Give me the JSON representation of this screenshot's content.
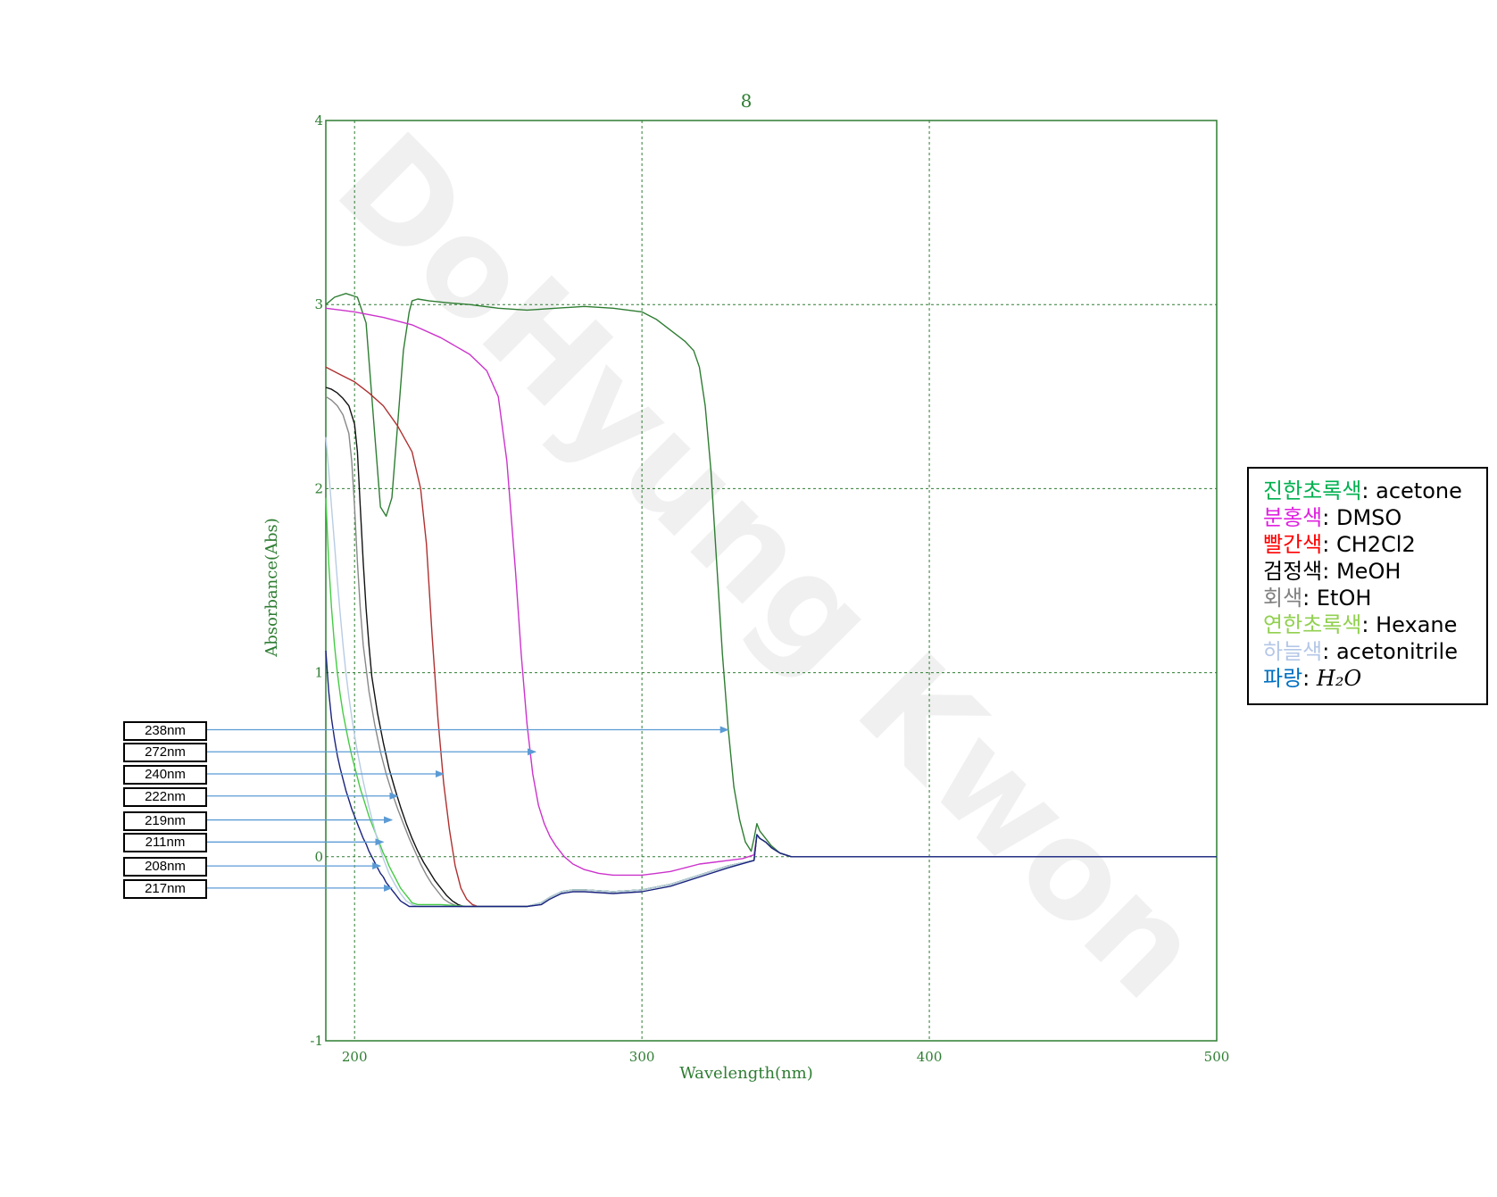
{
  "chart_data": {
    "type": "line",
    "title": "8",
    "xlabel": "Wavelength(nm)",
    "ylabel": "Absorbance(Abs)",
    "xlim": [
      190,
      500
    ],
    "ylim": [
      -1,
      4
    ],
    "xticks": [
      200,
      300,
      400,
      500
    ],
    "yticks": [
      -1,
      0,
      1,
      2,
      3,
      4
    ],
    "grid": true,
    "watermark": "DoHyung Kwon",
    "series": [
      {
        "key": "acetone",
        "color": "#2e7d32",
        "x": [
          190,
          193,
          197,
          201,
          204,
          207,
          209,
          211,
          213,
          215,
          217,
          219,
          220,
          222,
          226,
          232,
          240,
          250,
          260,
          270,
          280,
          290,
          300,
          305,
          310,
          315,
          318,
          320,
          322,
          324,
          326,
          328,
          330,
          332,
          334,
          336,
          338,
          339,
          340,
          341,
          343,
          345,
          348,
          352,
          360,
          380,
          400,
          430,
          460,
          500
        ],
        "y": [
          3.0,
          3.04,
          3.06,
          3.04,
          2.9,
          2.3,
          1.9,
          1.85,
          1.95,
          2.35,
          2.75,
          2.96,
          3.02,
          3.03,
          3.02,
          3.01,
          3.0,
          2.98,
          2.97,
          2.98,
          2.99,
          2.98,
          2.96,
          2.92,
          2.86,
          2.8,
          2.75,
          2.66,
          2.45,
          2.1,
          1.6,
          1.1,
          0.7,
          0.38,
          0.2,
          0.08,
          0.03,
          0.1,
          0.18,
          0.14,
          0.1,
          0.06,
          0.02,
          0.0,
          0.0,
          0.0,
          0.0,
          0.0,
          0.0,
          0.0
        ]
      },
      {
        "key": "DMSO",
        "color": "#cc33cc",
        "x": [
          190,
          200,
          210,
          220,
          230,
          240,
          246,
          250,
          253,
          256,
          258,
          260,
          262,
          264,
          266,
          268,
          270,
          273,
          276,
          280,
          285,
          290,
          295,
          300,
          305,
          310,
          315,
          320,
          325,
          330,
          335,
          339,
          340,
          341,
          343,
          345,
          348,
          352,
          360,
          380,
          400,
          430,
          460,
          500
        ],
        "y": [
          2.98,
          2.96,
          2.93,
          2.89,
          2.82,
          2.73,
          2.64,
          2.5,
          2.15,
          1.55,
          1.1,
          0.72,
          0.45,
          0.28,
          0.18,
          0.11,
          0.06,
          0.0,
          -0.04,
          -0.07,
          -0.09,
          -0.1,
          -0.1,
          -0.1,
          -0.09,
          -0.08,
          -0.06,
          -0.04,
          -0.03,
          -0.02,
          -0.01,
          0.01,
          0.12,
          0.1,
          0.08,
          0.05,
          0.02,
          0.0,
          0.0,
          0.0,
          0.0,
          0.0,
          0.0,
          0.0
        ]
      },
      {
        "key": "CH2Cl2",
        "color": "#b03030",
        "x": [
          190,
          195,
          200,
          205,
          210,
          215,
          220,
          223,
          225,
          227,
          229,
          231,
          233,
          235,
          237,
          239,
          241,
          243,
          250,
          260,
          265,
          268,
          272,
          276,
          280,
          290,
          300,
          310,
          320,
          330,
          339,
          340,
          341,
          343,
          345,
          348,
          352,
          360,
          380,
          400,
          430,
          460,
          500
        ],
        "y": [
          2.66,
          2.62,
          2.58,
          2.52,
          2.45,
          2.34,
          2.2,
          2.0,
          1.7,
          1.2,
          0.75,
          0.4,
          0.15,
          -0.05,
          -0.17,
          -0.23,
          -0.26,
          -0.27,
          -0.27,
          -0.27,
          -0.25,
          -0.22,
          -0.19,
          -0.18,
          -0.18,
          -0.19,
          -0.18,
          -0.15,
          -0.1,
          -0.05,
          -0.02,
          0.12,
          0.1,
          0.08,
          0.05,
          0.02,
          0.0,
          0.0,
          0.0,
          0.0,
          0.0,
          0.0,
          0.0
        ]
      },
      {
        "key": "MeOH",
        "color": "#111111",
        "x": [
          190,
          192,
          194,
          196,
          198,
          200,
          201,
          202,
          203,
          204,
          205,
          206,
          208,
          210,
          212,
          214,
          216,
          218,
          220,
          222,
          224,
          226,
          228,
          230,
          232,
          234,
          236,
          238,
          240,
          243,
          250,
          260,
          265,
          268,
          272,
          276,
          280,
          290,
          300,
          310,
          320,
          330,
          339,
          340,
          341,
          343,
          345,
          348,
          352,
          360,
          380,
          400,
          430,
          460,
          500
        ],
        "y": [
          2.55,
          2.54,
          2.52,
          2.49,
          2.45,
          2.35,
          2.2,
          1.9,
          1.6,
          1.35,
          1.15,
          0.98,
          0.78,
          0.62,
          0.48,
          0.37,
          0.27,
          0.18,
          0.1,
          0.03,
          -0.03,
          -0.08,
          -0.13,
          -0.17,
          -0.21,
          -0.24,
          -0.26,
          -0.27,
          -0.27,
          -0.27,
          -0.27,
          -0.27,
          -0.25,
          -0.22,
          -0.19,
          -0.18,
          -0.18,
          -0.19,
          -0.18,
          -0.15,
          -0.1,
          -0.05,
          -0.02,
          0.12,
          0.1,
          0.08,
          0.05,
          0.02,
          0.0,
          0.0,
          0.0,
          0.0,
          0.0,
          0.0,
          0.0
        ]
      },
      {
        "key": "EtOH",
        "color": "#888888",
        "x": [
          190,
          192,
          194,
          196,
          198,
          199,
          200,
          201,
          202,
          203,
          205,
          207,
          209,
          211,
          213,
          215,
          217,
          219,
          221,
          223,
          225,
          227,
          229,
          231,
          233,
          236,
          240,
          250,
          260,
          265,
          268,
          272,
          276,
          280,
          290,
          300,
          310,
          320,
          330,
          339,
          340,
          341,
          343,
          345,
          348,
          352,
          360,
          380,
          400,
          430,
          460,
          500
        ],
        "y": [
          2.5,
          2.48,
          2.45,
          2.4,
          2.3,
          2.15,
          1.9,
          1.6,
          1.35,
          1.15,
          0.9,
          0.72,
          0.57,
          0.45,
          0.35,
          0.26,
          0.18,
          0.1,
          0.03,
          -0.04,
          -0.1,
          -0.15,
          -0.19,
          -0.23,
          -0.25,
          -0.27,
          -0.27,
          -0.27,
          -0.27,
          -0.25,
          -0.22,
          -0.19,
          -0.18,
          -0.18,
          -0.19,
          -0.18,
          -0.15,
          -0.1,
          -0.05,
          -0.02,
          0.12,
          0.1,
          0.08,
          0.05,
          0.02,
          0.0,
          0.0,
          0.0,
          0.0,
          0.0,
          0.0,
          0.0
        ]
      },
      {
        "key": "Hexane",
        "color": "#44cc44",
        "x": [
          190,
          191,
          192,
          193,
          194,
          195,
          196,
          197,
          198,
          199,
          200,
          201,
          202,
          203,
          204,
          205,
          206,
          207,
          208,
          209,
          210,
          211,
          212,
          213,
          214,
          215,
          216,
          217,
          218,
          219,
          220,
          222,
          225,
          230,
          240,
          250,
          260,
          265,
          268,
          272,
          276,
          280,
          290,
          300,
          310,
          320,
          330,
          339,
          340,
          341,
          343,
          345,
          348,
          352,
          360,
          380,
          400,
          430,
          460,
          500
        ],
        "y": [
          1.95,
          1.6,
          1.35,
          1.15,
          1.0,
          0.88,
          0.78,
          0.7,
          0.62,
          0.55,
          0.49,
          0.43,
          0.37,
          0.32,
          0.27,
          0.22,
          0.18,
          0.14,
          0.1,
          0.06,
          0.02,
          -0.01,
          -0.05,
          -0.08,
          -0.11,
          -0.14,
          -0.17,
          -0.19,
          -0.21,
          -0.23,
          -0.25,
          -0.26,
          -0.26,
          -0.26,
          -0.27,
          -0.27,
          -0.27,
          -0.25,
          -0.22,
          -0.19,
          -0.18,
          -0.18,
          -0.19,
          -0.18,
          -0.15,
          -0.1,
          -0.05,
          -0.02,
          0.12,
          0.1,
          0.08,
          0.05,
          0.02,
          0.0,
          0.0,
          0.0,
          0.0,
          0.0,
          0.0,
          0.0
        ]
      },
      {
        "key": "acetonitrile",
        "color": "#b8cce4",
        "x": [
          190,
          191,
          192,
          193,
          194,
          195,
          196,
          197,
          198,
          199,
          200,
          201,
          202,
          203,
          204,
          205,
          206,
          207,
          208,
          209,
          210,
          212,
          214,
          216,
          218,
          220,
          222,
          225,
          230,
          240,
          250,
          260,
          265,
          268,
          272,
          276,
          280,
          290,
          300,
          310,
          320,
          330,
          339,
          340,
          341,
          343,
          345,
          348,
          352,
          360,
          380,
          400,
          430,
          460,
          500
        ],
        "y": [
          2.28,
          2.1,
          1.9,
          1.7,
          1.5,
          1.32,
          1.15,
          1.0,
          0.87,
          0.76,
          0.66,
          0.57,
          0.49,
          0.41,
          0.34,
          0.27,
          0.21,
          0.15,
          0.09,
          0.04,
          -0.01,
          -0.09,
          -0.15,
          -0.2,
          -0.24,
          -0.26,
          -0.27,
          -0.27,
          -0.27,
          -0.27,
          -0.27,
          -0.27,
          -0.25,
          -0.22,
          -0.19,
          -0.18,
          -0.18,
          -0.19,
          -0.18,
          -0.15,
          -0.1,
          -0.05,
          -0.02,
          0.12,
          0.1,
          0.08,
          0.05,
          0.02,
          0.0,
          0.0,
          0.0,
          0.0,
          0.0,
          0.0,
          0.0
        ]
      },
      {
        "key": "H2O",
        "color": "#1a237e",
        "x": [
          190,
          191,
          192,
          193,
          194,
          195,
          196,
          197,
          198,
          199,
          200,
          201,
          202,
          203,
          204,
          205,
          206,
          207,
          208,
          209,
          210,
          211,
          212,
          213,
          214,
          215,
          216,
          217,
          218,
          219,
          220,
          225,
          230,
          240,
          250,
          260,
          265,
          268,
          272,
          276,
          280,
          290,
          300,
          310,
          320,
          330,
          339,
          340,
          341,
          343,
          345,
          348,
          352,
          360,
          380,
          400,
          430,
          460,
          500
        ],
        "y": [
          1.12,
          0.9,
          0.75,
          0.64,
          0.55,
          0.48,
          0.42,
          0.36,
          0.31,
          0.26,
          0.22,
          0.18,
          0.14,
          0.1,
          0.07,
          0.03,
          0.0,
          -0.03,
          -0.06,
          -0.09,
          -0.11,
          -0.14,
          -0.16,
          -0.18,
          -0.2,
          -0.22,
          -0.24,
          -0.25,
          -0.26,
          -0.27,
          -0.27,
          -0.27,
          -0.27,
          -0.27,
          -0.27,
          -0.27,
          -0.26,
          -0.23,
          -0.2,
          -0.19,
          -0.19,
          -0.2,
          -0.19,
          -0.16,
          -0.11,
          -0.06,
          -0.02,
          0.12,
          0.1,
          0.08,
          0.05,
          0.02,
          0.0,
          0.0,
          0.0,
          0.0,
          0.0,
          0.0,
          0.0
        ]
      }
    ],
    "annotations": [
      {
        "label": "238nm",
        "x": 330,
        "y": 0.69
      },
      {
        "label": "272nm",
        "x": 263,
        "y": 0.57
      },
      {
        "label": "240nm",
        "x": 231,
        "y": 0.45
      },
      {
        "label": "222nm",
        "x": 215,
        "y": 0.33
      },
      {
        "label": "219nm",
        "x": 213,
        "y": 0.2
      },
      {
        "label": "211nm",
        "x": 210,
        "y": 0.08
      },
      {
        "label": "208nm",
        "x": 209,
        "y": -0.05
      },
      {
        "label": "217nm",
        "x": 213,
        "y": -0.17
      }
    ]
  },
  "legend": {
    "entries": [
      {
        "name": "진한초록색",
        "name_color": "#00b050",
        "desc": ": acetone"
      },
      {
        "name": "분홍색",
        "name_color": "#e020e0",
        "desc": ": DMSO"
      },
      {
        "name": "빨간색",
        "name_color": "#ff0000",
        "desc": ": CH2Cl2"
      },
      {
        "name": "검정색",
        "name_color": "#000000",
        "desc": ": MeOH"
      },
      {
        "name": "회색",
        "name_color": "#808080",
        "desc": ": EtOH"
      },
      {
        "name": "연한초록색",
        "name_color": "#92d050",
        "desc": ": Hexane"
      },
      {
        "name": "하늘색",
        "name_color": "#b4c7e7",
        "desc": ": acetonitrile"
      },
      {
        "name": "파랑",
        "name_color": "#0070c0",
        "desc": ": ",
        "formula": "H₂O"
      }
    ]
  }
}
